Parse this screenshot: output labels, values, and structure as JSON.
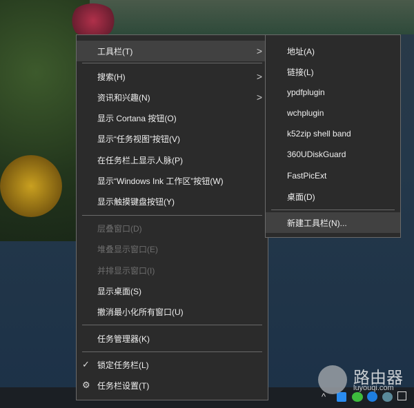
{
  "menu": {
    "items": [
      {
        "label": "工具栏(T)",
        "submenu": true,
        "state": "highlighted"
      },
      {
        "label": "搜索(H)",
        "submenu": true
      },
      {
        "label": "资讯和兴趣(N)",
        "submenu": true
      },
      {
        "label": "显示 Cortana 按钮(O)"
      },
      {
        "label": "显示“任务视图”按钮(V)"
      },
      {
        "label": "在任务栏上显示人脉(P)"
      },
      {
        "label": "显示“Windows Ink 工作区”按钮(W)"
      },
      {
        "label": "显示触摸键盘按钮(Y)"
      },
      {
        "label": "层叠窗口(D)",
        "disabled": true
      },
      {
        "label": "堆叠显示窗口(E)",
        "disabled": true
      },
      {
        "label": "并排显示窗口(I)",
        "disabled": true
      },
      {
        "label": "显示桌面(S)"
      },
      {
        "label": "撤消最小化所有窗口(U)"
      },
      {
        "label": "任务管理器(K)"
      },
      {
        "label": "锁定任务栏(L)",
        "checked": true
      },
      {
        "label": "任务栏设置(T)",
        "icon": "gear-icon"
      }
    ]
  },
  "submenu": {
    "items": [
      "地址(A)",
      "链接(L)",
      "ypdfplugin",
      "wchplugin",
      "k52zip shell band",
      "360UDiskGuard",
      "FastPicExt",
      "桌面(D)",
      "新建工具栏(N)..."
    ]
  },
  "watermark": {
    "title": "路由器",
    "site": "luyouqi.com"
  }
}
